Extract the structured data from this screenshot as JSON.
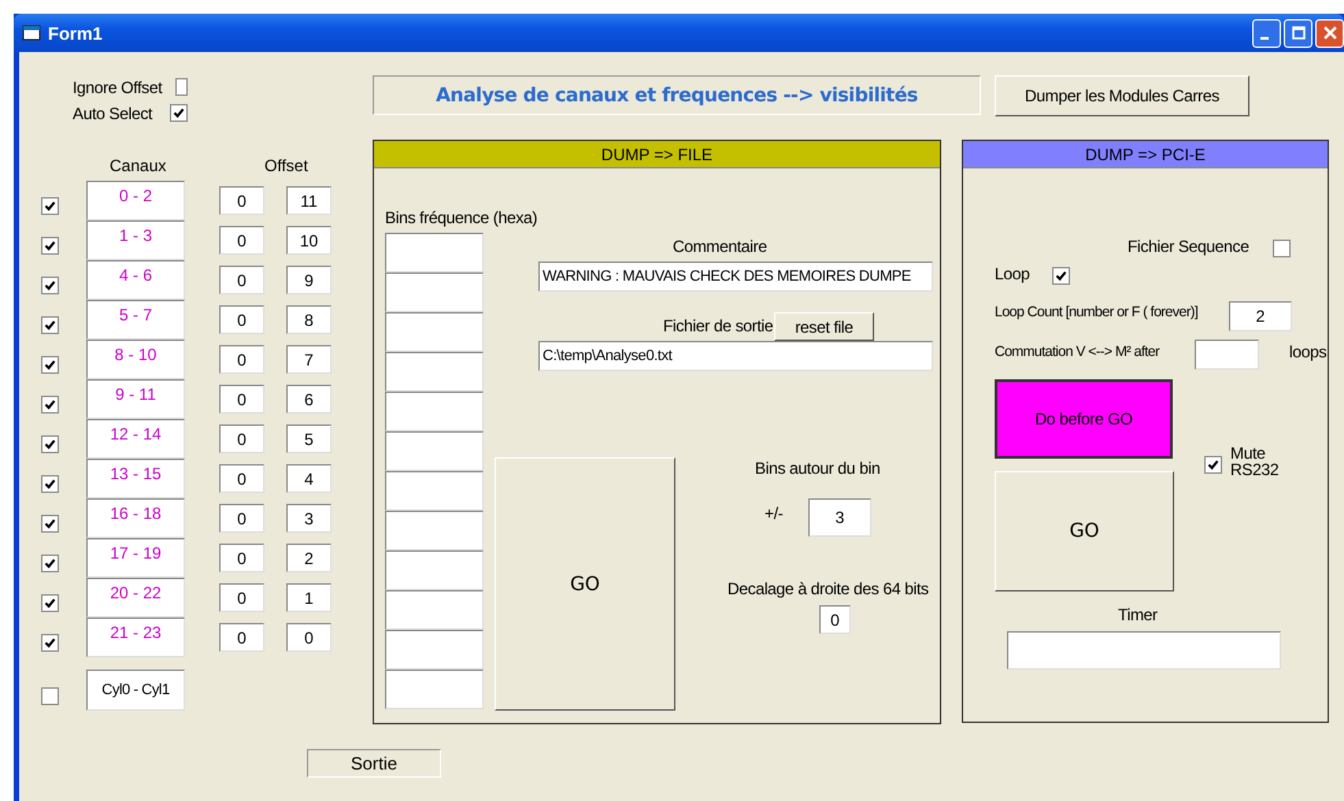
{
  "window": {
    "title": "Form1"
  },
  "options": [
    {
      "label": "Ignore Offset",
      "checked": false
    },
    {
      "label": "Auto Select",
      "checked": true
    }
  ],
  "banner": "Analyse de canaux et frequences --> visibilités",
  "dump_modules_button": "Dumper les Modules Carres",
  "channels": {
    "header_channels": "Canaux",
    "header_offset": "Offset",
    "rows": [
      {
        "checked": true,
        "range": "0 - 2",
        "offset_1": "0",
        "offset_2": "11"
      },
      {
        "checked": true,
        "range": "1 - 3",
        "offset_1": "0",
        "offset_2": "10"
      },
      {
        "checked": true,
        "range": "4 - 6",
        "offset_1": "0",
        "offset_2": "9"
      },
      {
        "checked": true,
        "range": "5 - 7",
        "offset_1": "0",
        "offset_2": "8"
      },
      {
        "checked": true,
        "range": "8 - 10",
        "offset_1": "0",
        "offset_2": "7"
      },
      {
        "checked": true,
        "range": "9 - 11",
        "offset_1": "0",
        "offset_2": "6"
      },
      {
        "checked": true,
        "range": "12 - 14",
        "offset_1": "0",
        "offset_2": "5"
      },
      {
        "checked": true,
        "range": "13 - 15",
        "offset_1": "0",
        "offset_2": "4"
      },
      {
        "checked": true,
        "range": "16 - 18",
        "offset_1": "0",
        "offset_2": "3"
      },
      {
        "checked": true,
        "range": "17 - 19",
        "offset_1": "0",
        "offset_2": "2"
      },
      {
        "checked": true,
        "range": "20 - 22",
        "offset_1": "0",
        "offset_2": "1"
      },
      {
        "checked": true,
        "range": "21 - 23",
        "offset_1": "0",
        "offset_2": "0"
      }
    ],
    "cyl": {
      "checked": false,
      "label": "Cyl0 - Cyl1"
    }
  },
  "sortie": "Sortie",
  "file_panel": {
    "title": "DUMP => FILE",
    "bins_label": "Bins fréquence (hexa)",
    "comment_label": "Commentaire",
    "comment": "WARNING : MAUVAIS CHECK DES MEMOIRES DUMPE",
    "output_label": "Fichier de sortie",
    "reset_button": "reset file",
    "output_path": "C:\\temp\\Analyse0.txt",
    "go_button": "GO",
    "bins_around_label": "Bins autour du bin",
    "plusminus": "+/-",
    "bins_around": "3",
    "shift_label": "Decalage à droite des 64 bits",
    "shift": "0"
  },
  "pci_panel": {
    "title": "DUMP => PCI-E",
    "sequence_label": "Fichier Sequence",
    "sequence_checked": false,
    "loop_label": "Loop",
    "loop_checked": true,
    "loop_count_label": "Loop Count [number or F ( forever)]",
    "loop_count": "2",
    "commutation_label": "Commutation V <--> M² after",
    "loops_label": "loops",
    "do_before_button": "Do before GO",
    "mute_checked": true,
    "mute_label_1": "Mute",
    "mute_label_2": "RS232",
    "go_button": "GO",
    "timer_label": "Timer"
  }
}
